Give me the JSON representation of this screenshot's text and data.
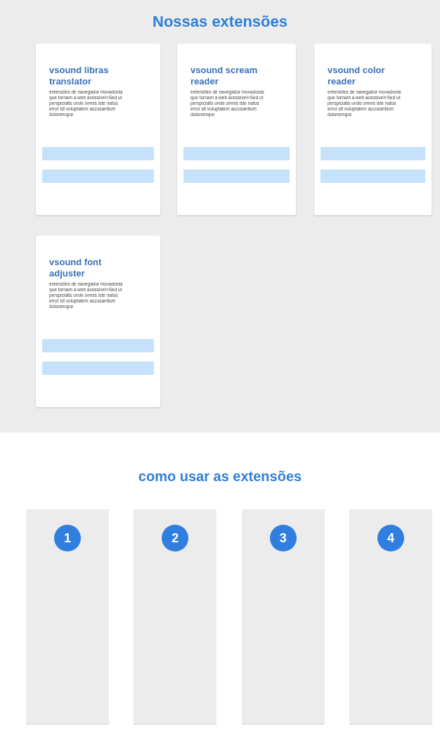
{
  "extensions_section": {
    "title": "Nossas extensões",
    "cards": [
      {
        "title": "vsound libras translator",
        "description": "extensões de navegador inovadoras que tornam a web acessível<Sed ut perspiciatis unde omnis iste natus error sit voluptatem accusantium doloremque"
      },
      {
        "title": "vsound scream reader",
        "description": "extensões de navegador inovadoras que tornam a web acessível<Sed ut perspiciatis unde omnis iste natus error sit voluptatem accusantium doloremque"
      },
      {
        "title": "vsound color reader",
        "description": "extensões de navegador inovadoras que tornam a web acessível<Sed ut perspiciatis unde omnis iste natus error sit voluptatem accusantium doloremque"
      },
      {
        "title": "vsound font adjuster",
        "description": "extensões de navegador inovadoras que tornam a web acessível<Sed ut perspiciatis unde omnis iste natus error sit voluptatem accusantium doloremque"
      }
    ]
  },
  "usage_section": {
    "title": "como usar as extensões",
    "steps": [
      {
        "number": "1"
      },
      {
        "number": "2"
      },
      {
        "number": "3"
      },
      {
        "number": "4"
      }
    ]
  }
}
